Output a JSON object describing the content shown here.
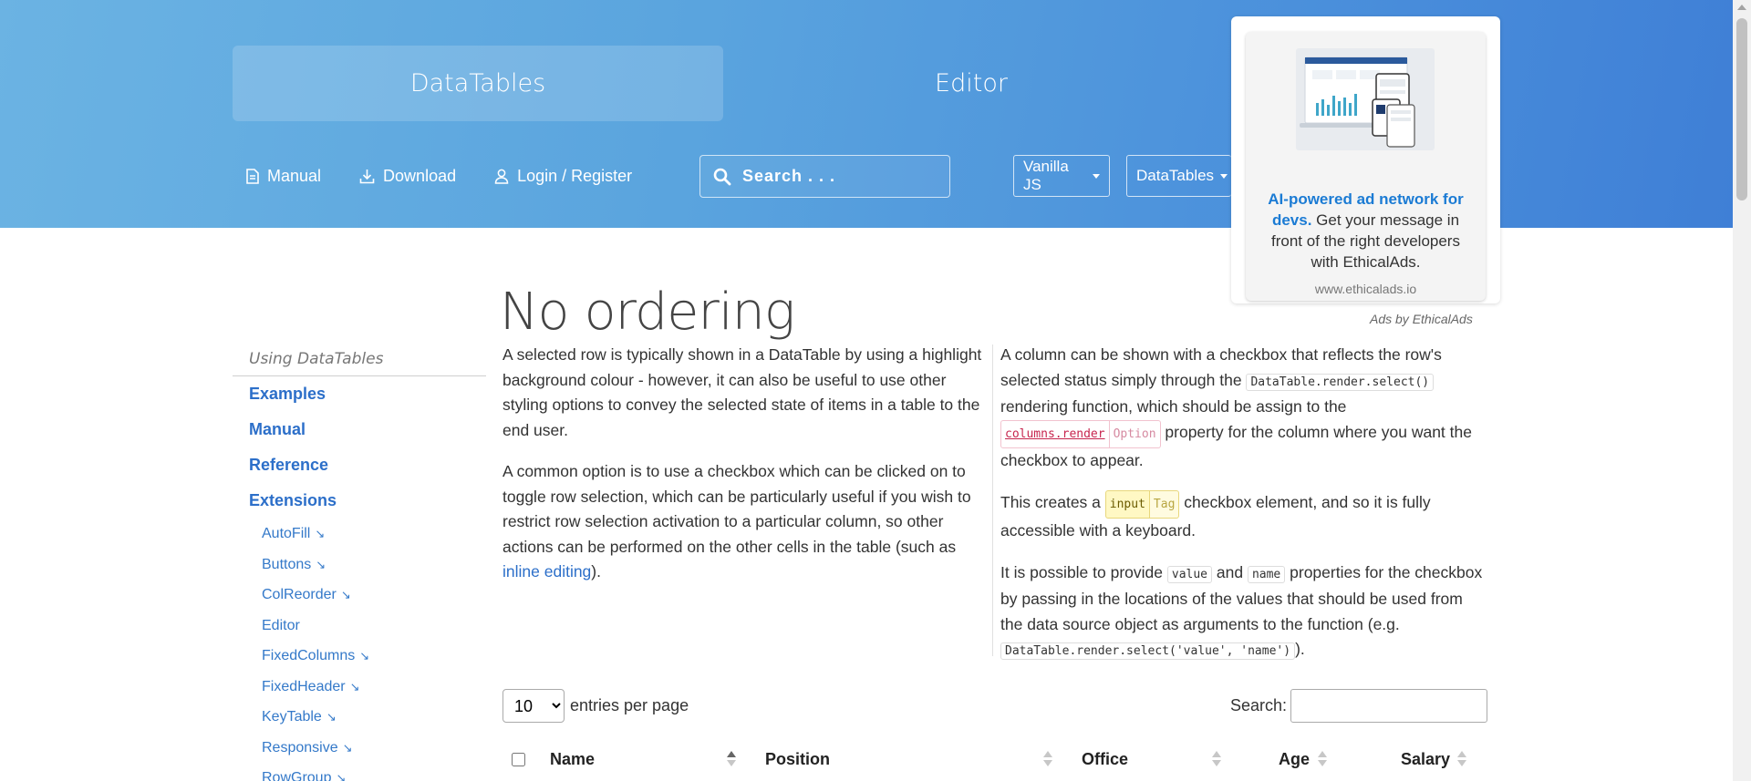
{
  "header": {
    "tabs": [
      {
        "label": "DataTables",
        "active": true
      },
      {
        "label": "Editor",
        "active": false
      }
    ],
    "nav": {
      "manual": "Manual",
      "download": "Download",
      "login": "Login / Register"
    },
    "search_placeholder": "Search . . .",
    "framework_select": "Vanilla JS",
    "styling_select": "DataTables",
    "gradient_colors": [
      "#6bb3e3",
      "#3f7fd6"
    ]
  },
  "ad": {
    "bold_text": "AI-powered ad network for devs.",
    "text": " Get your message in front of the right developers with EthicalAds.",
    "domain": "www.ethicalads.io",
    "attribution": "Ads by EthicalAds"
  },
  "sidebar": {
    "title": "Using DataTables",
    "main_items": [
      "Examples",
      "Manual",
      "Reference",
      "Extensions"
    ],
    "sub_items": [
      {
        "label": "AutoFill",
        "external": true
      },
      {
        "label": "Buttons",
        "external": true
      },
      {
        "label": "ColReorder",
        "external": true
      },
      {
        "label": "Editor",
        "external": false
      },
      {
        "label": "FixedColumns",
        "external": true
      },
      {
        "label": "FixedHeader",
        "external": true
      },
      {
        "label": "KeyTable",
        "external": true
      },
      {
        "label": "Responsive",
        "external": true
      },
      {
        "label": "RowGroup",
        "external": true
      }
    ],
    "external_arrow": "↘"
  },
  "page": {
    "title": "No ordering",
    "left": {
      "p1": "A selected row is typically shown in a DataTable by using a highlight background colour - however, it can also be useful to use other styling options to convey the selected state of items in a table to the end user.",
      "p2_pre": "A common option is to use a checkbox which can be clicked on to toggle row selection, which can be particularly useful if you wish to restrict row selection activation to a particular column, so other actions can be performed on the other cells in the table (such as ",
      "p2_link": "inline editing",
      "p2_post": ")."
    },
    "right": {
      "p1_a": "A column can be shown with a checkbox that reflects the row's selected status simply through the ",
      "p1_code": "DataTable.render.select()",
      "p1_b": " rendering function, which should be assign to the ",
      "p1_opt": "columns.render",
      "p1_opt_label": "Option",
      "p1_c": " property for the column where you want the checkbox to appear.",
      "p2_a": "This creates a ",
      "p2_tag": "input",
      "p2_tag_label": "Tag",
      "p2_b": " checkbox element, and so it is fully accessible with a keyboard.",
      "p3_a": "It is possible to provide ",
      "p3_code1": "value",
      "p3_b": " and ",
      "p3_code2": "name",
      "p3_c": " properties for the checkbox by passing in the locations of the values that should be used from the data source object as arguments to the function (e.g. ",
      "p3_code3": "DataTable.render.select('value', 'name')",
      "p3_d": ")."
    }
  },
  "table": {
    "entries_value": "10",
    "entries_label": "entries per page",
    "search_label": "Search:",
    "columns": [
      "Name",
      "Position",
      "Office",
      "Age",
      "Salary"
    ]
  }
}
